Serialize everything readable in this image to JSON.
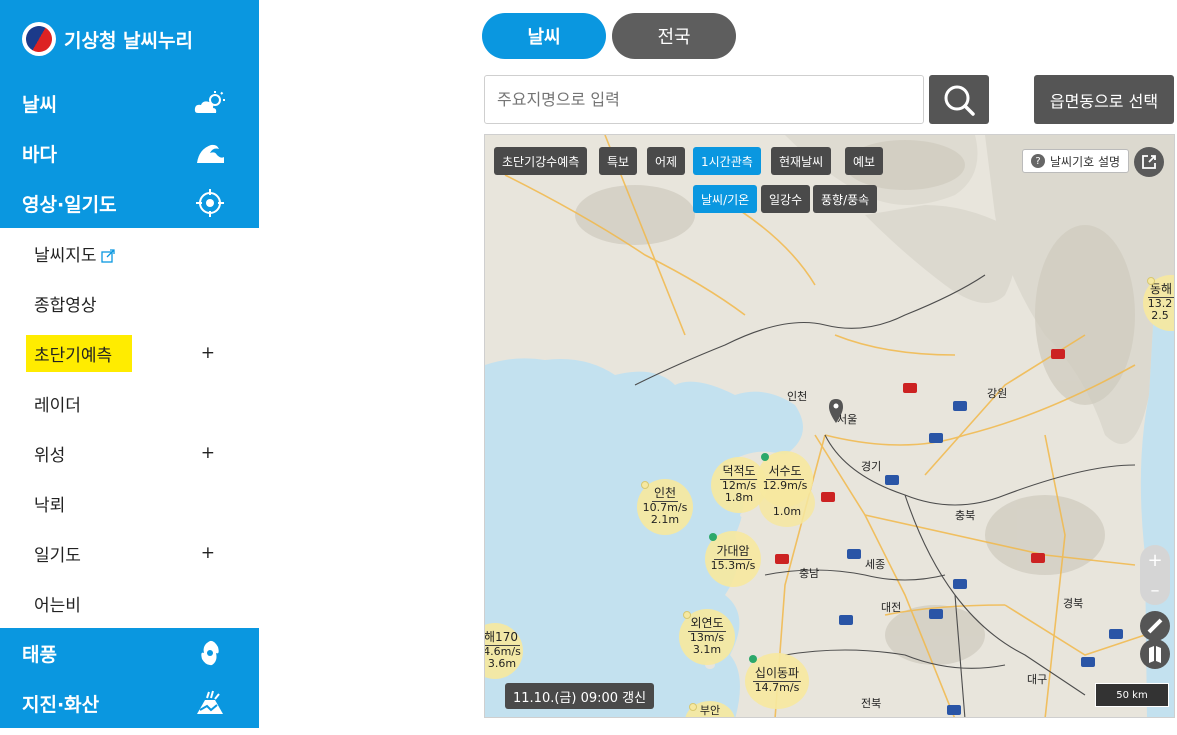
{
  "app": {
    "title": "기상청 날씨누리"
  },
  "sidebar": {
    "main_top": [
      {
        "label": "날씨",
        "icon": "partly-sunny-icon"
      },
      {
        "label": "바다",
        "icon": "wave-icon"
      },
      {
        "label": "영상·일기도",
        "icon": "satellite-target-icon"
      }
    ],
    "sub": [
      {
        "label": "날씨지도",
        "external": true,
        "expandable": false
      },
      {
        "label": "종합영상",
        "expandable": false
      },
      {
        "label": "초단기예측",
        "expandable": true,
        "plus": "+",
        "highlighted": true
      },
      {
        "label": "레이더",
        "expandable": false
      },
      {
        "label": "위성",
        "expandable": true,
        "plus": "+"
      },
      {
        "label": "낙뢰",
        "expandable": false
      },
      {
        "label": "일기도",
        "expandable": true,
        "plus": "+"
      },
      {
        "label": "어는비",
        "expandable": false
      }
    ],
    "main_bottom": [
      {
        "label": "태풍",
        "icon": "typhoon-icon"
      },
      {
        "label": "지진·화산",
        "icon": "volcano-icon"
      }
    ]
  },
  "tabs": {
    "weather": "날씨",
    "national": "전국"
  },
  "search": {
    "placeholder": "주요지명으로 입력",
    "region_button": "읍면동으로 선택"
  },
  "map": {
    "toolbar_row1": [
      "초단기강수예측",
      "특보",
      "어제",
      "1시간관측",
      "현재날씨",
      "예보"
    ],
    "toolbar_row1_active": "1시간관측",
    "toolbar_row2": [
      "날씨/기온",
      "일강수",
      "풍향/풍속"
    ],
    "toolbar_row2_active": "날씨/기온",
    "legend_button": "날씨기호 설명",
    "timestamp": "11.10.(금) 09:00 갱신",
    "scale": "50 km",
    "zoom_in": "+",
    "zoom_out": "–",
    "regions": [
      "강원",
      "경기",
      "충북",
      "충남",
      "세종",
      "대전",
      "경북",
      "전북",
      "대구",
      "인천",
      "서울"
    ],
    "stations": [
      {
        "name": "인천",
        "line1": "10.7m/s",
        "line2": "2.1m"
      },
      {
        "name": "덕적도",
        "line1": "12m/s",
        "line2": "1.8m"
      },
      {
        "name": "서수도",
        "line1": "12.9m/s",
        "line2": "1.0m"
      },
      {
        "name": "가대암",
        "line1": "15.3m/s",
        "line2": ""
      },
      {
        "name": "외연도",
        "line1": "13m/s",
        "line2": "3.1m"
      },
      {
        "name": "십이동파",
        "line1": "14.7m/s",
        "line2": ""
      },
      {
        "name": "해170",
        "line1": "4.6m/s",
        "line2": "3.6m"
      },
      {
        "name": "동해",
        "line1": "13.2",
        "line2": "2.5"
      },
      {
        "name": "부안",
        "line1": "",
        "line2": ""
      }
    ]
  }
}
